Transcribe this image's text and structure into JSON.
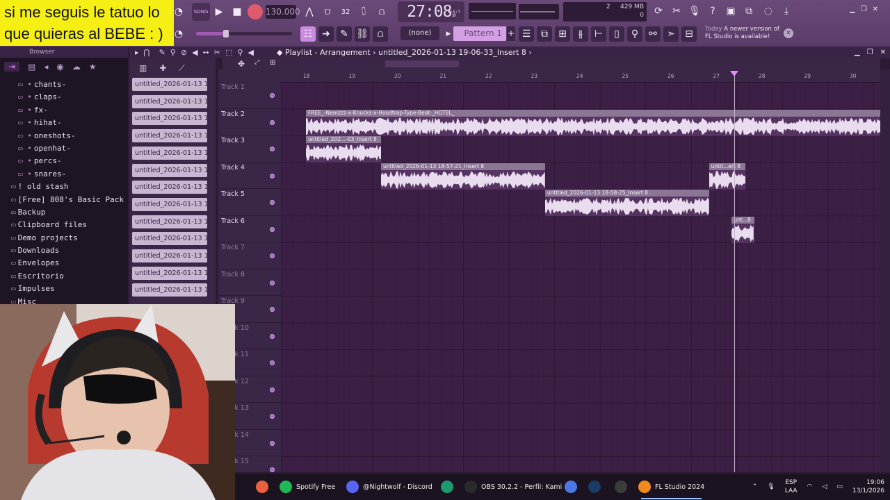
{
  "caption": {
    "line1": "si me seguis le tatuo lo",
    "line2": "que quieras al BEBE : )"
  },
  "toolbar": {
    "song_mode": "SONG",
    "tempo": "130.000",
    "time_main": "27:08",
    "time_sub": "10",
    "time_unit": "B:S:T",
    "mem_value": "429 MB",
    "mem_count": "2",
    "mem_zero": "0",
    "pattern_none": "(none)",
    "pattern_name": "Pattern 1",
    "pattern_add": "+",
    "notice_when": "Today",
    "notice_text": "A newer version of FL Studio is available!"
  },
  "browser": {
    "title": "Browser",
    "items": [
      {
        "label": "chants-",
        "level": "sub"
      },
      {
        "label": "claps-",
        "level": "sub"
      },
      {
        "label": "fx-",
        "level": "sub"
      },
      {
        "label": "hihat-",
        "level": "sub"
      },
      {
        "label": "oneshots-",
        "level": "sub"
      },
      {
        "label": "openhat-",
        "level": "sub"
      },
      {
        "label": "percs-",
        "level": "sub"
      },
      {
        "label": "snares-",
        "level": "sub"
      },
      {
        "label": "! old stash",
        "level": "top"
      },
      {
        "label": "[Free] 808's Basic Pack",
        "level": "top"
      },
      {
        "label": "Backup",
        "level": "top"
      },
      {
        "label": "Clipboard files",
        "level": "top"
      },
      {
        "label": "Demo projects",
        "level": "top"
      },
      {
        "label": "Downloads",
        "level": "top"
      },
      {
        "label": "Envelopes",
        "level": "top"
      },
      {
        "label": "Escritorio",
        "level": "top"
      },
      {
        "label": "Impulses",
        "level": "top"
      },
      {
        "label": "Misc",
        "level": "top"
      }
    ]
  },
  "picker": {
    "items": [
      "untitled_2026-01-13 19-",
      "untitled_2026-01-13 19-",
      "untitled_2026-01-13 19-",
      "untitled_2026-01-13 19-",
      "untitled_2026-01-13 19-",
      "untitled_2026-01-13 19-",
      "untitled_2026-01-13 19-",
      "untitled_2026-01-13 19-",
      "untitled_2026-01-13 19-",
      "untitled_2026-01-13 19-",
      "untitled_2026-01-13 19-",
      "untitled_2026-01-13 19-",
      "untitled_2026-01-13 19-"
    ]
  },
  "playlist": {
    "title_prefix": "Playlist - Arrangement",
    "title_sep": "›",
    "project": "untitled_2026-01-13 19-06-33_Insert 8",
    "ruler": [
      "18",
      "19",
      "20",
      "21",
      "22",
      "23",
      "24",
      "25",
      "26",
      "27",
      "28",
      "29",
      "30"
    ],
    "tracks": [
      {
        "label": "Track 1",
        "dim": true
      },
      {
        "label": "Track 2",
        "dim": false
      },
      {
        "label": "Track 3",
        "dim": false
      },
      {
        "label": "Track 4",
        "dim": false
      },
      {
        "label": "Track 5",
        "dim": false
      },
      {
        "label": "Track 6",
        "dim": false
      },
      {
        "label": "Track 7",
        "dim": true
      },
      {
        "label": "Track 8",
        "dim": true
      },
      {
        "label": "Track 9",
        "dim": true
      },
      {
        "label": "Track 10",
        "dim": true
      },
      {
        "label": "Track 11",
        "dim": true
      },
      {
        "label": "Track 12",
        "dim": true
      },
      {
        "label": "Track 13",
        "dim": true
      },
      {
        "label": "Track 14",
        "dim": true
      },
      {
        "label": "Track 15",
        "dim": true
      }
    ],
    "clips": [
      {
        "label": "FREE_-Nemzzz-x-Knucks-x-Hoodtrap-Type-Beat-_HOTEL_",
        "track": 2,
        "start": 18.0,
        "end": 31.1
      },
      {
        "label": "untitled_202...-03_Insert 8",
        "track": 3,
        "start": 18.0,
        "end": 19.65
      },
      {
        "label": "untitled_2026-01-13 18-57-21_Insert 8",
        "track": 4,
        "start": 19.65,
        "end": 23.25
      },
      {
        "label": "untitled_2026-01-13 18-58-25_Insert 8",
        "track": 5,
        "start": 23.25,
        "end": 26.85
      },
      {
        "label": "untit...ert 8",
        "track": 4,
        "start": 26.85,
        "end": 27.65
      },
      {
        "label": "unt...8",
        "track": 6,
        "start": 27.35,
        "end": 27.85
      }
    ],
    "playhead": 27.4
  },
  "taskbar": {
    "items": [
      {
        "name": "firefox",
        "label": "",
        "color": "#e8613c"
      },
      {
        "name": "spotify",
        "label": "Spotify Free",
        "color": "#1db954"
      },
      {
        "name": "discord",
        "label": "@Nightwolf - Discord",
        "color": "#5865f2"
      },
      {
        "name": "app-green",
        "label": "",
        "color": "#1c9c6e"
      },
      {
        "name": "obs",
        "label": "OBS 30.2.2 - Perfil: Kami",
        "color": "#2a2a2a"
      },
      {
        "name": "copilot",
        "label": "",
        "color": "#4b78e6"
      },
      {
        "name": "steam",
        "label": "",
        "color": "#1b3a64"
      },
      {
        "name": "app-box",
        "label": "",
        "color": "#3c3c3c"
      },
      {
        "name": "fl-studio",
        "label": "FL Studio 2024",
        "color": "#f08a1c"
      }
    ],
    "lang_top": "ESP",
    "lang_bottom": "LAA",
    "time": "19:06",
    "date": "13/1/2026"
  }
}
